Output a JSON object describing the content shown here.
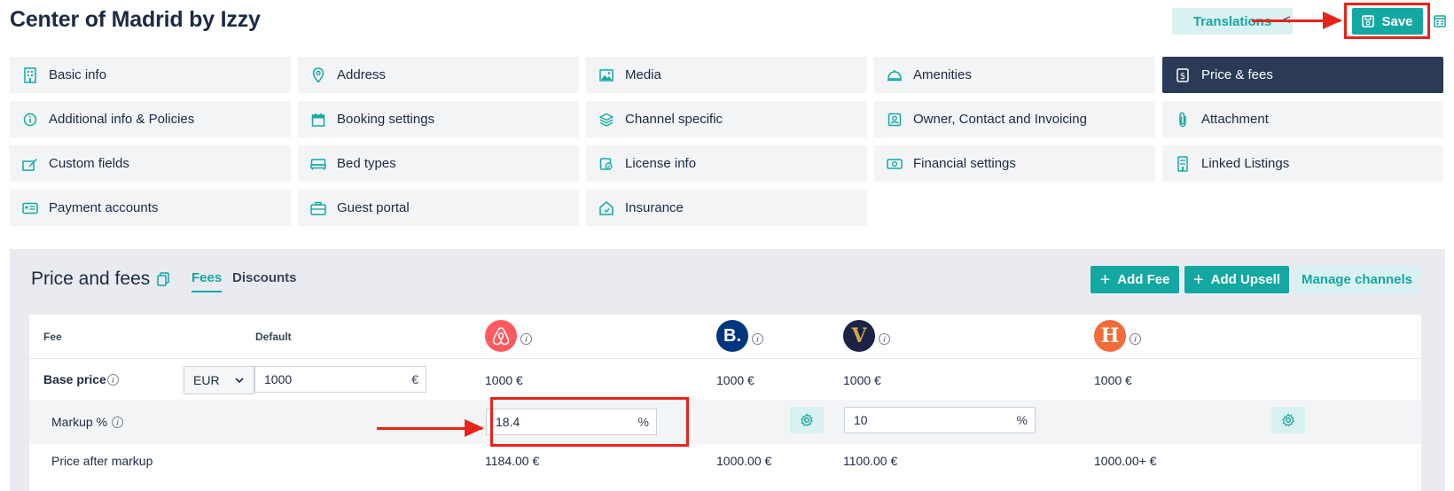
{
  "page": {
    "title": "Center of Madrid by Izzy"
  },
  "toolbar": {
    "translations_label": "Translations",
    "lt_glyph": "<",
    "save_label": "Save"
  },
  "nav": [
    {
      "label": "Basic info",
      "icon": "building-icon"
    },
    {
      "label": "Address",
      "icon": "location-pin-icon"
    },
    {
      "label": "Media",
      "icon": "image-icon"
    },
    {
      "label": "Amenities",
      "icon": "service-bell-icon"
    },
    {
      "label": "Price & fees",
      "icon": "dollar-receipt-icon",
      "active": true
    },
    {
      "label": "Additional info & Policies",
      "icon": "info-circle-icon"
    },
    {
      "label": "Booking settings",
      "icon": "calendar-icon"
    },
    {
      "label": "Channel specific",
      "icon": "layers-icon"
    },
    {
      "label": "Owner, Contact and Invoicing",
      "icon": "contact-card-icon"
    },
    {
      "label": "Attachment",
      "icon": "paperclip-icon"
    },
    {
      "label": "Custom fields",
      "icon": "edit-field-icon"
    },
    {
      "label": "Bed types",
      "icon": "bed-icon"
    },
    {
      "label": "License info",
      "icon": "license-shield-icon"
    },
    {
      "label": "Financial settings",
      "icon": "money-icon"
    },
    {
      "label": "Linked Listings",
      "icon": "building-link-icon"
    },
    {
      "label": "Payment accounts",
      "icon": "id-card-icon"
    },
    {
      "label": "Guest portal",
      "icon": "briefcase-icon"
    },
    {
      "label": "Insurance",
      "icon": "house-shield-icon"
    }
  ],
  "panel": {
    "title": "Price and fees",
    "tabs": {
      "fees": "Fees",
      "discounts": "Discounts"
    },
    "add_fee_label": "Add Fee",
    "add_upsell_label": "Add Upsell",
    "manage_channels_label": "Manage channels"
  },
  "table": {
    "headers": {
      "fee": "Fee",
      "default": "Default"
    },
    "channels": [
      {
        "name": "airbnb",
        "color": "#ff5a5f"
      },
      {
        "name": "booking",
        "color": "#003580",
        "glyph": "B."
      },
      {
        "name": "vrbo",
        "color": "#1c2347",
        "glyph": "V"
      },
      {
        "name": "hostaway",
        "color": "#f26b38",
        "glyph": "H"
      }
    ],
    "base_price": {
      "label": "Base price",
      "currency": "EUR",
      "default_value": "1000",
      "default_suffix": "€",
      "airbnb": "1000 €",
      "booking": "1000 €",
      "vrbo": "1000 €",
      "hostaway": "1000 €"
    },
    "markup": {
      "label": "Markup %",
      "airbnb_value": "18.4",
      "airbnb_suffix": "%",
      "vrbo_value": "10",
      "vrbo_suffix": "%"
    },
    "price_after_markup": {
      "label": "Price after markup",
      "airbnb": "1184.00 €",
      "booking": "1000.00 €",
      "vrbo": "1100.00 €",
      "hostaway": "1000.00+ €"
    }
  },
  "colors": {
    "accent": "#14a8a3",
    "highlight": "#e8231a",
    "active_nav": "#2b3a55"
  }
}
